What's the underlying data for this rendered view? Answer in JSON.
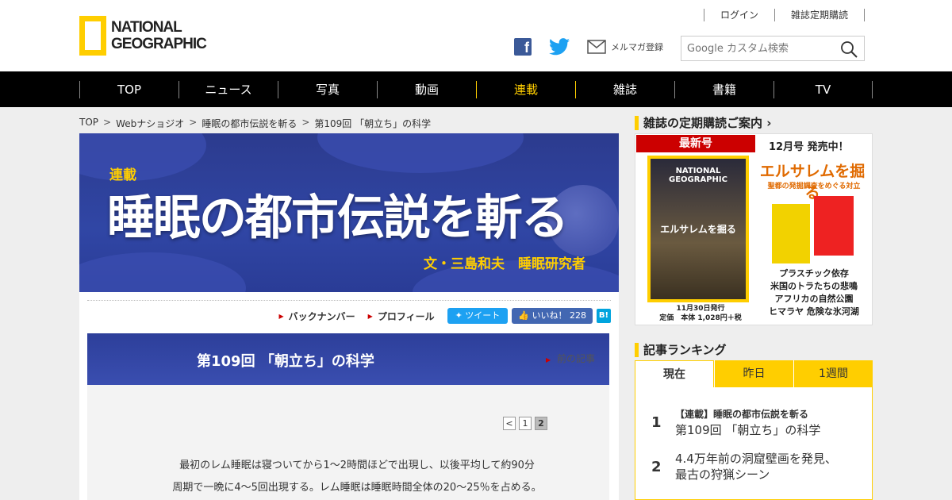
{
  "header": {
    "logo_text_1": "NATIONAL",
    "logo_text_2": "GEOGRAPHIC",
    "login": "ログイン",
    "subscribe": "雑誌定期購読",
    "mailmag": "メルマガ登録",
    "search_placeholder": "Google カスタム検索"
  },
  "nav": {
    "items": [
      "TOP",
      "ニュース",
      "写真",
      "動画",
      "連載",
      "雑誌",
      "書籍",
      "TV"
    ],
    "active": "連載",
    "active_color": "#ffce00"
  },
  "breadcrumb": [
    "TOP",
    "Webナショジオ",
    "睡眠の都市伝説を斬る",
    "第109回 「朝立ち」の科学"
  ],
  "banner": {
    "tag": "連載",
    "title": "睡眠の都市伝説を斬る",
    "author": "文・三島和夫　睡眠研究者"
  },
  "tools": {
    "backnumber": "バックナンバー",
    "profile": "プロフィール",
    "tweet": "ツイート",
    "like": "いいね！ 228",
    "hatena": "B!"
  },
  "episode": {
    "title": "第109回 「朝立ち」の科学",
    "prev": "前の記事"
  },
  "pager": [
    "<",
    "1",
    "2"
  ],
  "article": {
    "line1": "最初のレム睡眠は寝ついてから1〜2時間ほどで出現し、以後平均して約90分",
    "line2": "周期で一晩に4～5回出現する。レム睡眠は睡眠時間全体の20〜25％を占める。"
  },
  "sidebar": {
    "subscription_heading": "雑誌の定期購読ご案内",
    "latest_label": "最新号",
    "issue": "12月号 発売中！",
    "cover_brand": "NATIONAL GEOGRAPHIC",
    "cover_title": "エルサレムを掘る",
    "feature_title": "エルサレムを掘る",
    "feature_sub": "聖都の発掘調査をめぐる対立",
    "topics": [
      "プラスチック依存",
      "米国のトラたちの悲鳴",
      "アフリカの自然公園",
      "ヒマラヤ 危険な氷河湖"
    ],
    "release": "11月30日発行",
    "price": "定価　本体 1,028円＋税",
    "ranking_heading": "記事ランキング",
    "tabs": [
      "現在",
      "昨日",
      "1週間"
    ],
    "ranking": [
      {
        "num": "1",
        "tag": "【連載】睡眠の都市伝説を斬る",
        "title": "第109回 「朝立ち」の科学"
      },
      {
        "num": "2",
        "tag": "",
        "title": "4.4万年前の洞窟壁画を発見、",
        "title2": "最古の狩猟シーン"
      }
    ]
  },
  "colors": {
    "brand_yellow": "#ffce00",
    "nav_bg": "#000000",
    "banner_blue": "#3046a5",
    "latest_red": "#cc0000"
  }
}
